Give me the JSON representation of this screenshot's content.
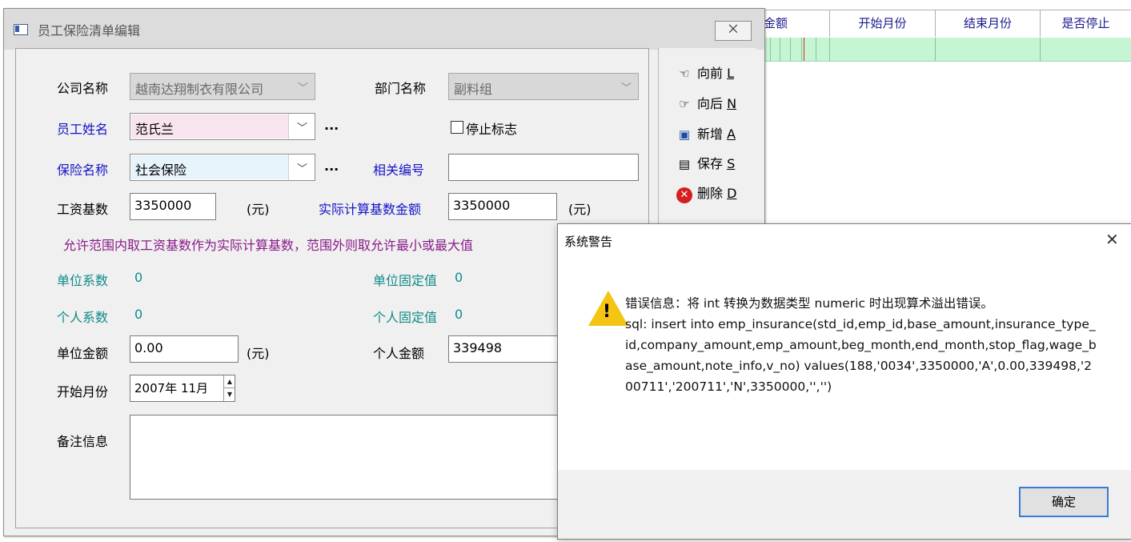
{
  "grid": {
    "columns": [
      "金额",
      "开始月份",
      "结束月份",
      "是否停止"
    ]
  },
  "window": {
    "title": "员工保险清单编辑",
    "close_label": "⨉"
  },
  "form": {
    "company_label": "公司名称",
    "company_value": "越南达翔制衣有限公司",
    "dept_label": "部门名称",
    "dept_value": "副料组",
    "emp_label": "员工姓名",
    "emp_value": "范氏兰",
    "stop_flag_label": "停止标志",
    "insurance_label": "保险名称",
    "insurance_value": "社会保险",
    "related_no_label": "相关编号",
    "related_no_value": "",
    "salary_base_label": "工资基数",
    "salary_base_value": "3350000",
    "unit_yuan": "(元)",
    "actual_base_label": "实际计算基数金额",
    "actual_base_value": "3350000",
    "hint": "允许范围内取工资基数作为实际计算基数，范围外则取允许最小或最大值",
    "company_coef_label": "单位系数",
    "company_coef_value": "0",
    "company_fixed_label": "单位固定值",
    "company_fixed_value": "0",
    "personal_coef_label": "个人系数",
    "personal_coef_value": "0",
    "personal_fixed_label": "个人固定值",
    "personal_fixed_value": "0",
    "company_amount_label": "单位金额",
    "company_amount_value": "0.00",
    "personal_amount_label": "个人金额",
    "personal_amount_value": "339498",
    "start_month_label": "开始月份",
    "start_month_value": "2007年 11月",
    "note_label": "备注信息",
    "ellipsis": "..."
  },
  "side": {
    "prev": "向前 ",
    "prev_key": "L",
    "next": "向后 ",
    "next_key": "N",
    "add": "新增 ",
    "add_key": "A",
    "save": "保存 ",
    "save_key": "S",
    "delete": "删除 ",
    "delete_key": "D"
  },
  "dialog": {
    "title": "系统警告",
    "close": "✕",
    "message_line1": "错误信息：将 int 转换为数据类型 numeric 时出现算术溢出错误。",
    "message_line2": "sql: insert into emp_insurance(std_id,emp_id,base_amount,insurance_type_id,company_amount,emp_amount,beg_month,end_month,stop_flag,wage_base_amount,note_info,v_no) values(188,'0034',3350000,'A',0.00,339498,'200711','200711','N',3350000,'','')",
    "ok": "确定"
  },
  "colors": {
    "grid_row": "#c6f5d4",
    "label_blue": "#1414c8",
    "label_teal": "#108a8a",
    "hint_purple": "#8a1a8a",
    "warning_yellow": "#f4c515"
  }
}
